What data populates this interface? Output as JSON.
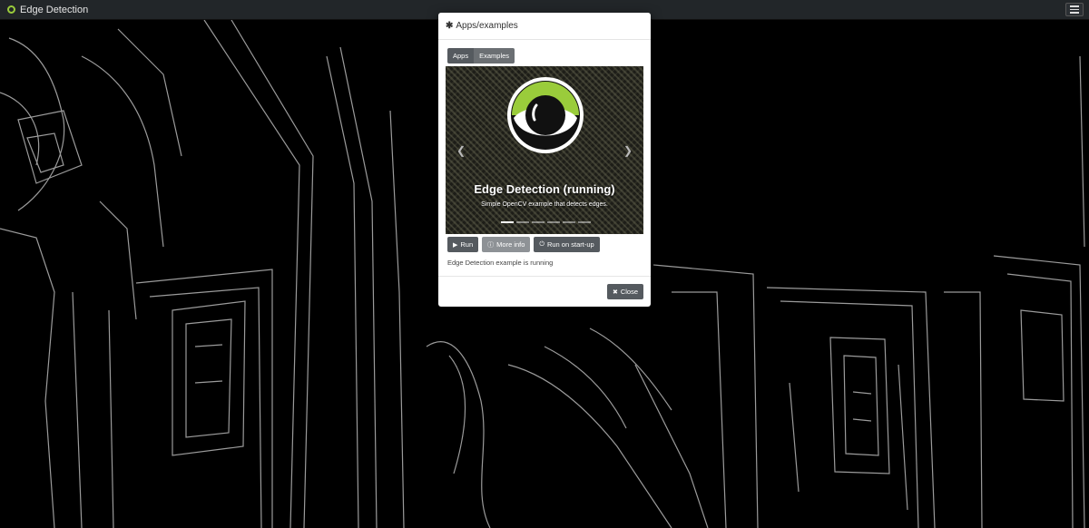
{
  "app": {
    "title": "Edge Detection",
    "brand_color": "#9acc3b"
  },
  "modal": {
    "title": "Apps/examples",
    "title_icon": "asterisk-icon",
    "tabs": [
      {
        "label": "Apps",
        "active": true
      },
      {
        "label": "Examples",
        "active": false
      }
    ],
    "carousel": {
      "slide_title": "Edge Detection (running)",
      "slide_subtitle": "Simple OpenCV example that detects edges.",
      "slide_count": 6,
      "active_slide": 1
    },
    "actions": {
      "run_label": "Run",
      "more_info_label": "More info",
      "startup_label": "Run on start-up"
    },
    "status": "Edge Detection example is running",
    "close_label": "Close"
  },
  "colors": {
    "navbar": "#222629",
    "button": "#555a5f",
    "button_light": "#8e9296",
    "eye_green": "#9acc3b"
  }
}
